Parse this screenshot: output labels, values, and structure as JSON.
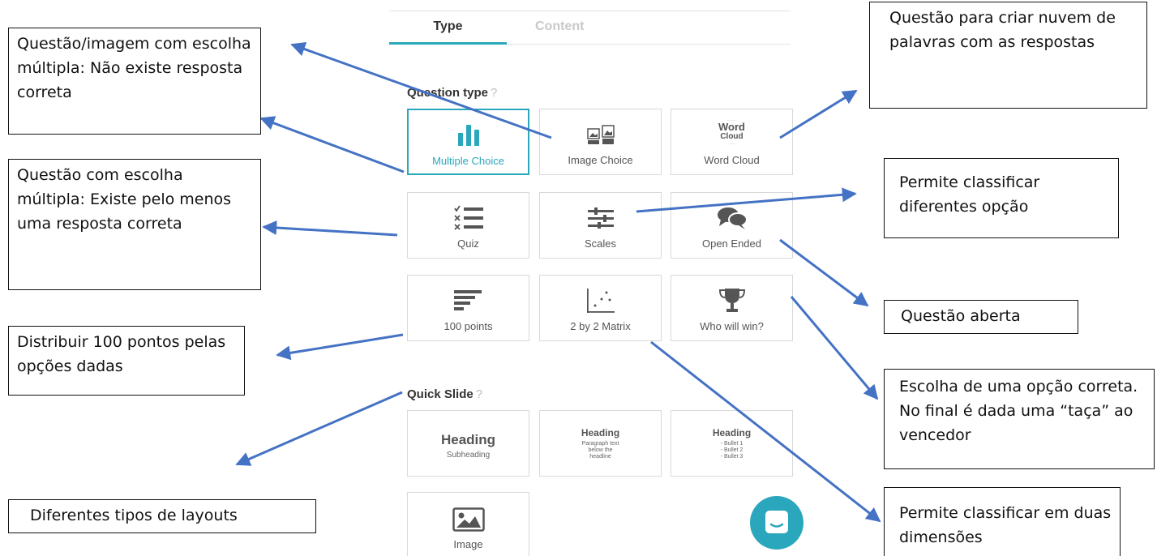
{
  "tabs": {
    "type": "Type",
    "content": "Content"
  },
  "sections": {
    "question_type": {
      "title": "Question type",
      "help": "?"
    },
    "quick_slide": {
      "title": "Quick Slide",
      "help": "?"
    }
  },
  "question_types": [
    {
      "label": "Multiple Choice",
      "icon": "bar-chart-icon",
      "selected": true
    },
    {
      "label": "Image Choice",
      "icon": "image-choice-icon"
    },
    {
      "label": "Word Cloud",
      "icon": "word-cloud-icon",
      "icon_words": [
        "Word",
        "Cloud"
      ]
    },
    {
      "label": "Quiz",
      "icon": "quiz-list-icon"
    },
    {
      "label": "Scales",
      "icon": "sliders-icon"
    },
    {
      "label": "Open Ended",
      "icon": "chat-bubbles-icon"
    },
    {
      "label": "100 points",
      "icon": "horizontal-bars-icon"
    },
    {
      "label": "2 by 2 Matrix",
      "icon": "scatter-matrix-icon"
    },
    {
      "label": "Who will win?",
      "icon": "trophy-icon"
    }
  ],
  "quick_slides": [
    {
      "heading": "Heading",
      "sub": "Subheading"
    },
    {
      "heading": "Heading",
      "sub": "Paragraph text below the headline"
    },
    {
      "heading": "Heading",
      "bullets": [
        "- Bullet 1",
        "- Bullet 2",
        "- Bullet 3"
      ]
    },
    {
      "label": "Image",
      "icon": "image-icon"
    }
  ],
  "annotations": {
    "choice_no_answer": "Questão/imagem com escolha múltipla: Não existe resposta correta",
    "quiz": "Questão com escolha múltipla: Existe pelo menos uma resposta correta",
    "points": "Distribuir 100 pontos pelas opções dadas",
    "layouts": "Diferentes tipos de layouts",
    "word_cloud": "Questão para criar nuvem de palavras com as respostas",
    "scales": "Permite classificar diferentes opção",
    "open_ended": "Questão aberta",
    "who_will_win": "Escolha de uma opção correta. No final é dada uma “taça” ao vencedor",
    "matrix": "Permite classificar em duas dimensões"
  },
  "colors": {
    "accent": "#2aa7bd",
    "arrow": "#4472c4",
    "icon_dark": "#555555"
  }
}
